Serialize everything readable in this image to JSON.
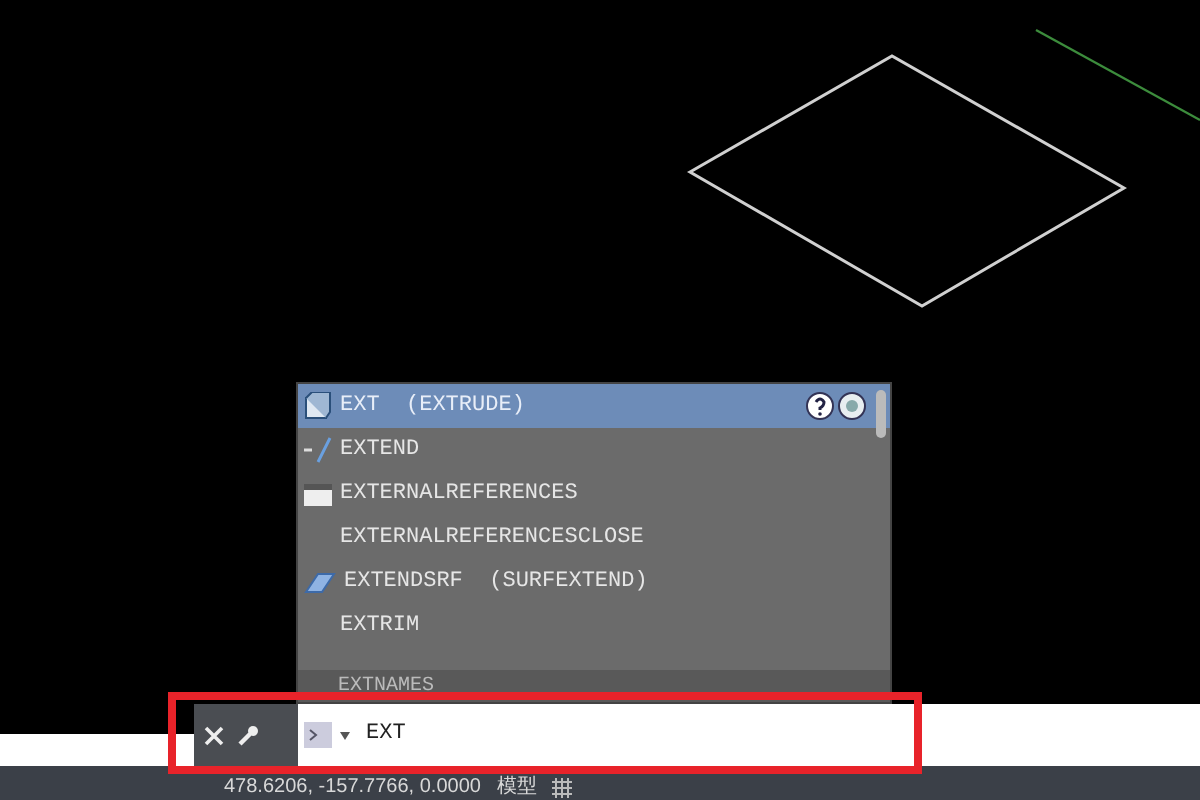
{
  "autocomplete": {
    "items": [
      {
        "label": "EXT  (EXTRUDE)",
        "kind": "extrude",
        "selected": true
      },
      {
        "label": "EXTEND",
        "kind": "extend",
        "selected": false
      },
      {
        "label": "EXTERNALREFERENCES",
        "kind": "xref",
        "selected": false
      },
      {
        "label": "EXTERNALREFERENCESCLOSE",
        "kind": "plain",
        "selected": false
      },
      {
        "label": "EXTENDSRF  (SURFEXTEND)",
        "kind": "surface",
        "selected": false
      },
      {
        "label": "EXTRIM",
        "kind": "plain",
        "selected": false
      }
    ],
    "partial_item": "EXTNAMES"
  },
  "command_line": {
    "value": "EXT"
  },
  "status_bar": {
    "coordinates": "478.6206, -157.7766, 0.0000",
    "space": "模型"
  }
}
